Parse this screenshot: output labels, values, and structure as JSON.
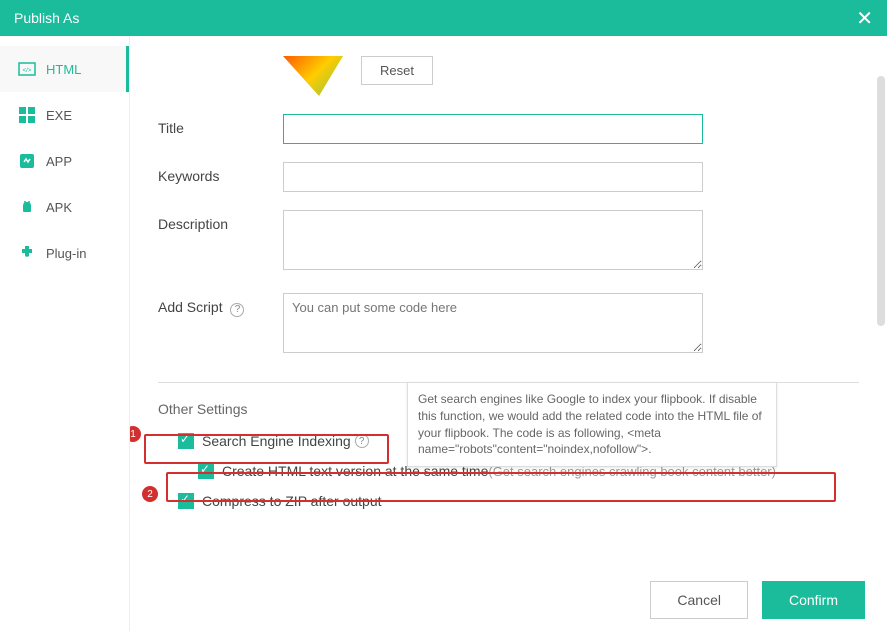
{
  "titlebar": {
    "title": "Publish As"
  },
  "sidebar": {
    "items": [
      {
        "label": "HTML",
        "icon": "html"
      },
      {
        "label": "EXE",
        "icon": "exe"
      },
      {
        "label": "APP",
        "icon": "app"
      },
      {
        "label": "APK",
        "icon": "apk"
      },
      {
        "label": "Plug-in",
        "icon": "plugin"
      }
    ]
  },
  "form": {
    "reset_label": "Reset",
    "title_label": "Title",
    "keywords_label": "Keywords",
    "description_label": "Description",
    "addscript_label": "Add Script",
    "addscript_placeholder": "You can put some code here"
  },
  "other": {
    "section_title": "Other Settings",
    "search_engine_label": "Search Engine Indexing",
    "create_html_label": "Create HTML text version at the same time",
    "create_html_hint": "(Get search engines crawling book content better)",
    "compress_label": "Compress to ZIP after output"
  },
  "tooltip": {
    "text": " Get search engines like Google to index your flipbook. If disable this function, we would add the related code into the HTML file of your flipbook. The code is as following, <meta name=\"robots\"content=\"noindex,nofollow\">."
  },
  "footer": {
    "cancel_label": "Cancel",
    "confirm_label": "Confirm"
  },
  "annotations": {
    "badge1": "1",
    "badge2": "2"
  }
}
